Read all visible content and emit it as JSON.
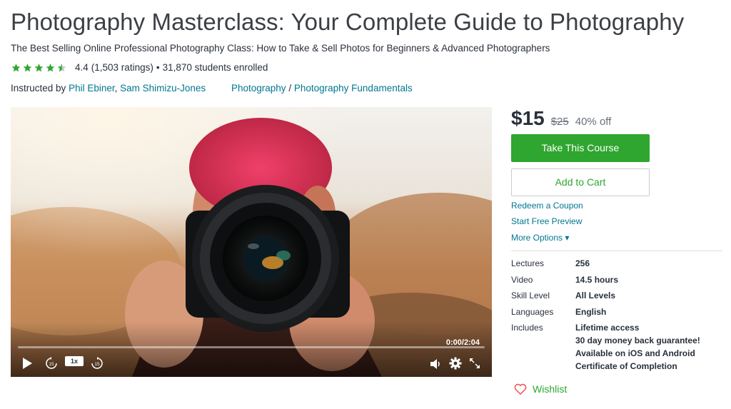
{
  "course": {
    "title": "Photography Masterclass: Your Complete Guide to Photography",
    "subtitle": "The Best Selling Online Professional Photography Class: How to Take & Sell Photos for Beginners & Advanced Photographers",
    "rating_value": "4.4",
    "rating_count": "(1,503 ratings)",
    "bullet": "•",
    "students": "31,870 students enrolled",
    "stars_fill": 4.4,
    "instructed_by": "Instructed by",
    "instructors": [
      "Phil Ebiner",
      "Sam Shimizu-Jones"
    ],
    "instructor_sep": ",",
    "category": "Photography",
    "breadcrumb_sep": "/",
    "subcategory": "Photography Fundamentals"
  },
  "video": {
    "time": "0:00/2:04",
    "speed": "1x",
    "skip_seconds": "15",
    "progress": 0,
    "icons": [
      "play-icon",
      "rewind-15-icon",
      "forward-15-icon",
      "volume-icon",
      "settings-icon",
      "fullscreen-icon"
    ]
  },
  "purchase": {
    "price": "$15",
    "old_price": "$25",
    "discount": "40% off",
    "take_course": "Take This Course",
    "add_to_cart": "Add to Cart",
    "redeem": "Redeem a Coupon",
    "preview": "Start Free Preview",
    "more_options": "More Options ▾"
  },
  "details": {
    "lectures_label": "Lectures",
    "lectures_value": "256",
    "video_label": "Video",
    "video_value": "14.5 hours",
    "skill_label": "Skill Level",
    "skill_value": "All Levels",
    "languages_label": "Languages",
    "languages_value": "English",
    "includes_label": "Includes",
    "includes": [
      "Lifetime access",
      "30 day money back guarantee!",
      "Available on iOS and Android",
      "Certificate of Completion"
    ]
  },
  "wishlist": {
    "label": "Wishlist"
  },
  "colors": {
    "green": "#2ea62f",
    "link": "#007791",
    "star": "#2ea62f"
  }
}
